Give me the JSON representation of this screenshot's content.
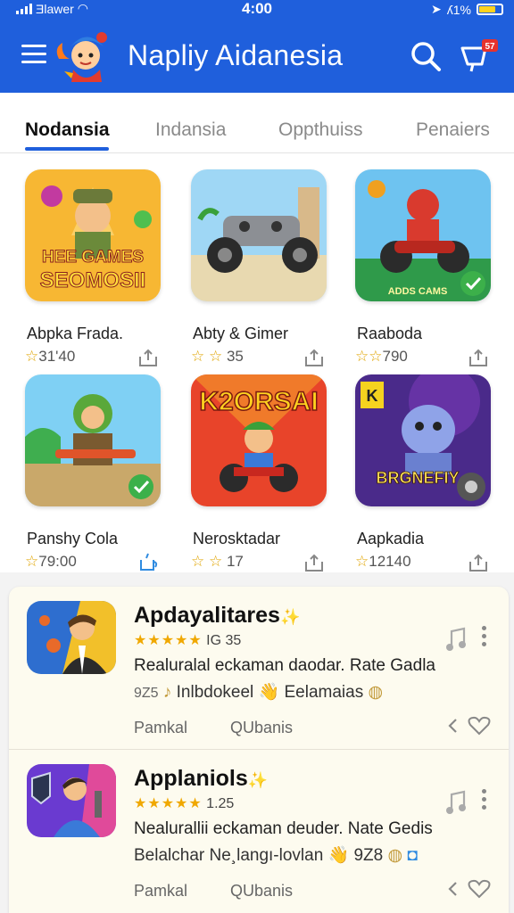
{
  "status_bar": {
    "carrier": "Ǝlawer",
    "time": "4:00",
    "battery": "ʎ1%"
  },
  "app_bar": {
    "title": "Napliy Aidanesia",
    "cart_badge": "57"
  },
  "tabs": [
    {
      "label": "Nodansia",
      "active": true
    },
    {
      "label": "Indansia",
      "active": false
    },
    {
      "label": "Oppthuiss",
      "active": false
    },
    {
      "label": "Penaiers",
      "active": false
    }
  ],
  "grid": [
    {
      "name": "Abpka Frada.",
      "stars": "☆",
      "rating": "31'40",
      "art_text": "HEE GAMES SEOMOSII"
    },
    {
      "name": "Abty & Gimer",
      "stars": "☆ ☆",
      "rating": "35",
      "art_text": ""
    },
    {
      "name": "Raaboda",
      "stars": "☆☆",
      "rating": "790",
      "art_text": "ADDS CAMS"
    },
    {
      "name": "Panshy Cola",
      "stars": "☆",
      "rating": "79:00",
      "art_text": ""
    },
    {
      "name": "Nerosktadar",
      "stars": "☆ ☆",
      "rating": "17",
      "art_text": "K2ORSAI"
    },
    {
      "name": "Aapkadia",
      "stars": "☆",
      "rating": "12140",
      "art_text": "BRGNEFIY"
    }
  ],
  "list": [
    {
      "title": "Apdayalitares",
      "stars": "★★★★★",
      "rating": "IG 35",
      "desc": "Realuralal eckaman daodar. Rate Gadla",
      "sub_prefix": "9Z5",
      "sub_text": "Inlbdokeel 👋 Eelamaias",
      "action_a": "Pamkal",
      "action_b": "QUbanis"
    },
    {
      "title": "Applaniols",
      "stars": "★★★★★",
      "rating": "1.25",
      "desc": "Nealurallii eckaman deuder. Nate Gedis",
      "sub_prefix": "",
      "sub_text": "Belalchar Ne¸langı-lovlan 👋 9Z8",
      "action_a": "Pamkal",
      "action_b": "QUbanis"
    }
  ],
  "colors": {
    "primary": "#1f5fdc",
    "star": "#e0a400",
    "list_bg": "#fdfbef"
  }
}
